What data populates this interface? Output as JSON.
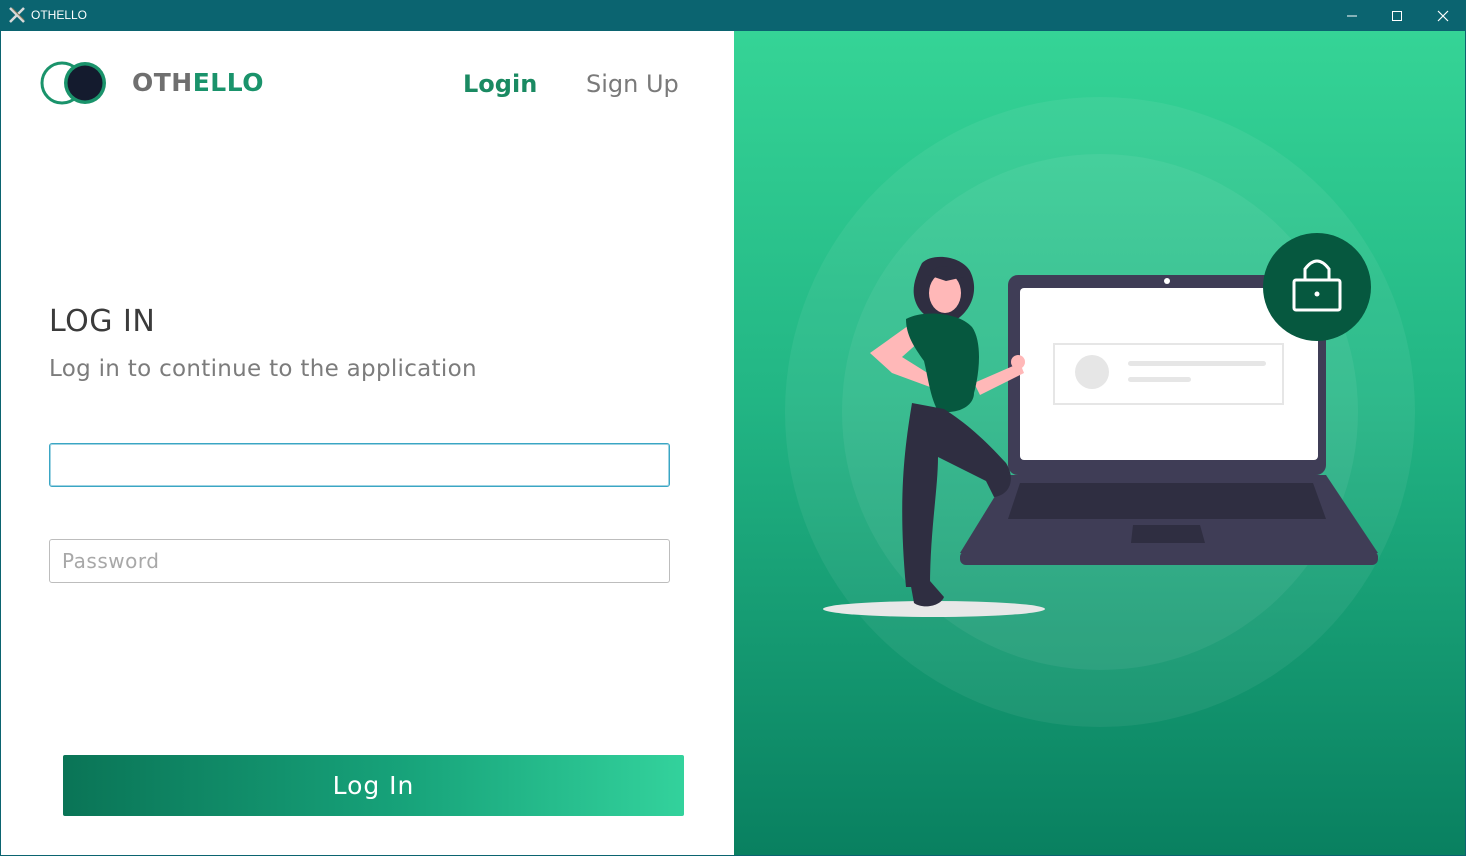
{
  "window": {
    "title": "OTHELLO",
    "controls": [
      "minimize",
      "maximize",
      "close"
    ]
  },
  "brand": {
    "part_gray": "OTH",
    "part_green": "ELLO"
  },
  "nav": {
    "login": "Login",
    "signup": "Sign Up"
  },
  "form": {
    "heading": "LOG IN",
    "subheading": "Log in to continue to the application",
    "username": {
      "value": "",
      "placeholder": ""
    },
    "password": {
      "value": "",
      "placeholder": "Password"
    },
    "submit_label": "Log In"
  },
  "colors": {
    "titlebar": "#0b6470",
    "accent": "#1a936b",
    "panel_gradient_top": "#35d496",
    "panel_gradient_bottom": "#098060"
  },
  "icons": {
    "app": "othello-x-icon",
    "logo": "othello-disc-logo",
    "lock": "lock-icon"
  }
}
